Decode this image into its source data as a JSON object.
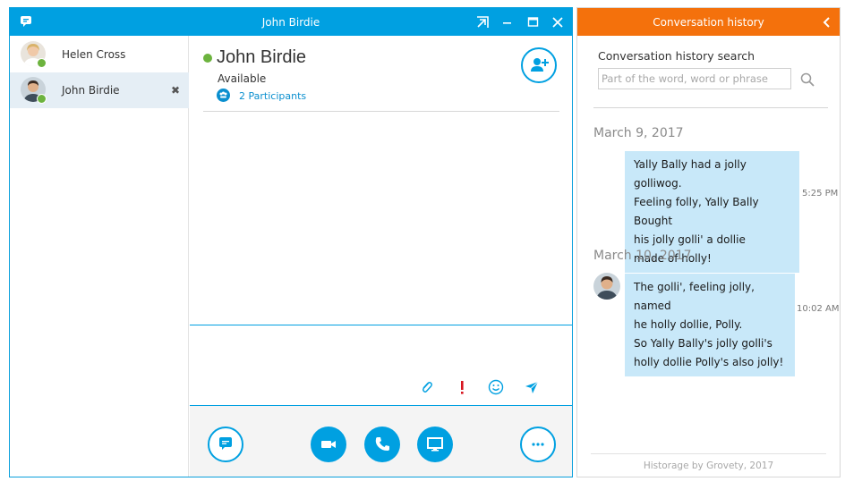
{
  "window": {
    "title": "John Birdie"
  },
  "sidebar": {
    "contacts": [
      {
        "name": "Helen Cross",
        "presence": "available",
        "active": false
      },
      {
        "name": "John Birdie",
        "presence": "available",
        "active": true,
        "close": "✖"
      }
    ]
  },
  "conversation": {
    "name": "John Birdie",
    "status": "Available",
    "participants": "2 Participants"
  },
  "colors": {
    "accent": "#00a0e1",
    "history_header": "#f4710c",
    "bubble": "#c8e8f9",
    "presence": "#6cb33e"
  },
  "history": {
    "title": "Conversation history",
    "search_label": "Conversation history search",
    "search_placeholder": "Part of the word, word or phrase",
    "search_value": "",
    "groups": [
      {
        "date": "March 9, 2017",
        "messages": [
          {
            "lines": [
              "Yally Bally had a jolly golliwog.",
              "Feeling folly, Yally Bally Bought",
              "his jolly golli' a dollie",
              "made of holly!"
            ],
            "time": "5:25 PM"
          }
        ]
      },
      {
        "date": "March 10, 2017",
        "messages": [
          {
            "lines": [
              "The golli', feeling jolly, named",
              "he holly dollie, Polly.",
              "So Yally Bally's jolly golli's",
              "holly dollie Polly's also jolly!"
            ],
            "time": "10:02 AM"
          }
        ]
      }
    ],
    "footer": "Historage by Grovety, 2017"
  },
  "icons": {
    "app": "chat-bubble-icon",
    "popout": "popout-icon",
    "minimize": "minimize-icon",
    "maximize": "maximize-icon",
    "close": "close-icon",
    "add_person": "add-person-icon",
    "attach": "paperclip-icon",
    "importance": "exclamation-icon",
    "emoji": "smiley-icon",
    "send": "send-icon",
    "im": "chat-icon",
    "video": "video-icon",
    "call": "phone-icon",
    "share": "screen-share-icon",
    "more": "ellipsis-icon",
    "back": "chevron-left-icon",
    "search": "search-icon"
  }
}
